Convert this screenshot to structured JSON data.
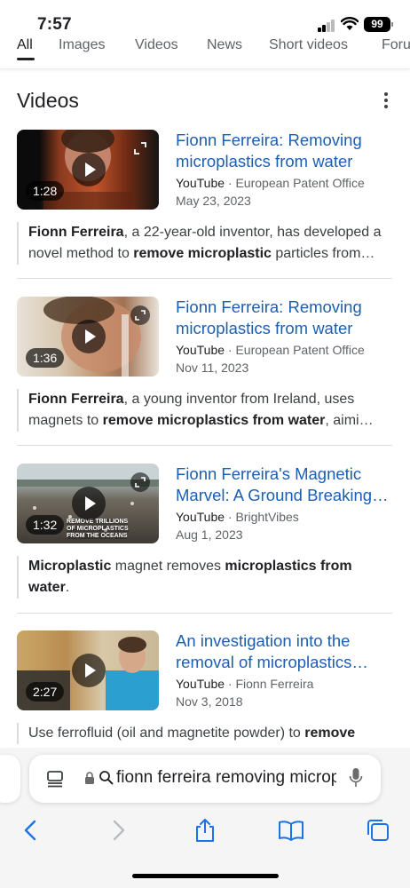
{
  "status_bar": {
    "time": "7:57",
    "battery": "99"
  },
  "tabs": [
    "All",
    "Images",
    "Videos",
    "News",
    "Short videos",
    "Forums"
  ],
  "section": {
    "title": "Videos"
  },
  "results": [
    {
      "title_line1": "Fionn Ferreira: Removing",
      "title_line2": "microplastics from water",
      "source": "YouTube",
      "channel": "European Patent Office",
      "date": "May 23, 2023",
      "duration": "1:28",
      "snippet_line1": [
        {
          "t": "Fionn Ferreira",
          "b": true
        },
        {
          "t": ", a 22-year-old inventor, has developed a",
          "b": false
        }
      ],
      "snippet_line2": [
        {
          "t": "novel method to ",
          "b": false
        },
        {
          "t": "remove microplastic",
          "b": true
        },
        {
          "t": " particles from…",
          "b": false
        }
      ]
    },
    {
      "title_line1": "Fionn Ferreira: Removing",
      "title_line2": "microplastics from water",
      "source": "YouTube",
      "channel": "European Patent Office",
      "date": "Nov 11, 2023",
      "duration": "1:36",
      "snippet_line1": [
        {
          "t": "Fionn Ferreira",
          "b": true
        },
        {
          "t": ", a young inventor from Ireland, uses",
          "b": false
        }
      ],
      "snippet_line2": [
        {
          "t": "magnets to ",
          "b": false
        },
        {
          "t": "remove microplastics from water",
          "b": true
        },
        {
          "t": ", aimi…",
          "b": false
        }
      ]
    },
    {
      "title_line1": "Fionn Ferreira's Magnetic",
      "title_line2": "Marvel: A Ground Breaking…",
      "source": "YouTube",
      "channel": "BrightVibes",
      "date": "Aug 1, 2023",
      "duration": "1:32",
      "thumb_caption": "REMOVE TRILLIONS OF MICROPLASTICS FROM THE OCEANS",
      "snippet_line1": [
        {
          "t": "Microplastic",
          "b": true
        },
        {
          "t": " magnet removes ",
          "b": false
        },
        {
          "t": "microplastics from",
          "b": true
        }
      ],
      "snippet_line2": [
        {
          "t": "water",
          "b": true
        },
        {
          "t": ".",
          "b": false
        }
      ]
    },
    {
      "title_line1": "An investigation into the",
      "title_line2": "removal of microplastics…",
      "source": "YouTube",
      "channel": "Fionn Ferreira",
      "date": "Nov 3, 2018",
      "duration": "2:27",
      "snippet_line1": [
        {
          "t": "Use ferrofluid (oil and magnetite powder) to ",
          "b": false
        },
        {
          "t": "remove",
          "b": true
        }
      ],
      "snippet_line2": []
    }
  ],
  "address_bar": {
    "query": "fionn ferreira removing microplastics"
  },
  "colors": {
    "link": "#1a5fb4",
    "text": "#202124",
    "muted": "#5f6368"
  },
  "icons": [
    "tab-overview-icon",
    "lock-icon",
    "search-icon",
    "microphone-icon",
    "back-icon",
    "forward-icon",
    "share-icon",
    "bookmarks-icon",
    "tabs-icon"
  ]
}
